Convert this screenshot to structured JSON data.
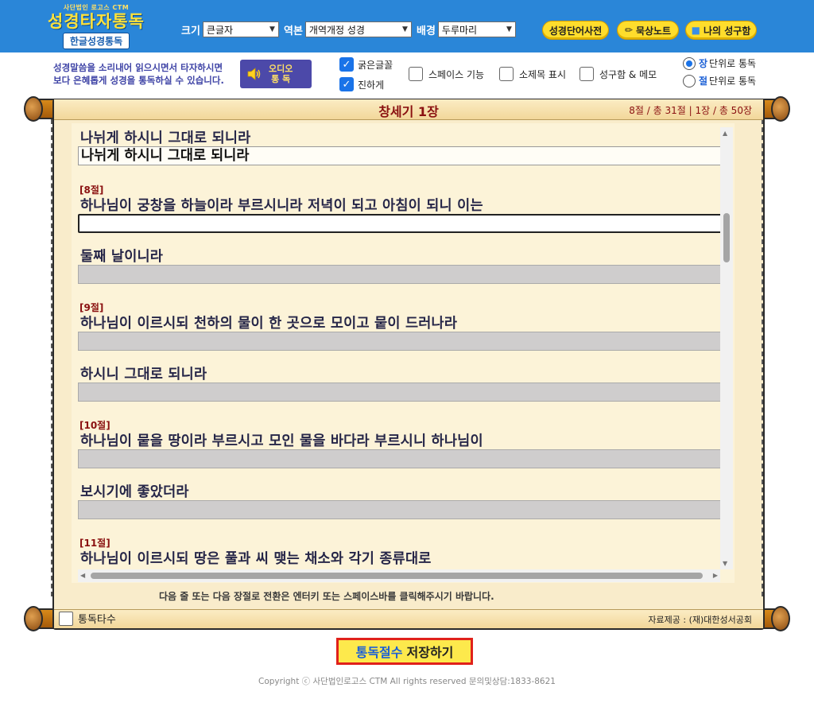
{
  "header": {
    "logo_sub": "사단법인 로고스 CTM",
    "logo_main": "성경타자통독",
    "logo_pill": "한글성경통독",
    "size_label": "크기",
    "size_value": "큰글자",
    "version_label": "역본",
    "version_value": "개역개정 성경",
    "background_label": "배경",
    "background_value": "두루마리",
    "buttons": {
      "dictionary": "성경단어사전",
      "notebook": "묵상노트",
      "my_verses": "나의 성구함"
    }
  },
  "options": {
    "notice_line1": "성경말씀을 소리내어 읽으시면서 타자하시면",
    "notice_line2": "보다 은혜롭게 성경을 통독하실 수 있습니다.",
    "audio_line1": "오디오",
    "audio_line2": "통  독",
    "bold_font": "굵은글꼴",
    "darker": "진하게",
    "space_feature": "스페이스 기능",
    "subtitle_show": "소제목 표시",
    "verse_memo": "성구함 & 메모",
    "radio_chapter_key": "장",
    "radio_chapter_rest": "단위로 통독",
    "radio_verse_key": "절",
    "radio_verse_rest": "단위로 통독"
  },
  "scroll": {
    "chapter_title": "창세기 1장",
    "progress": "8절 / 총 31절  |  1장 / 총 50장"
  },
  "reading": {
    "lines": [
      {
        "text": "나뉘게 하시니 그대로 되니라",
        "typed": "나뉘게 하시니 그대로 되니라"
      },
      {
        "verse": "[8절]",
        "text": "하나님이 궁창을 하늘이라 부르시니라 저녁이 되고 아침이 되니 이는"
      },
      {
        "text": "둘째 날이니라"
      },
      {
        "verse": "[9절]",
        "text": "하나님이 이르시되 천하의 물이 한 곳으로 모이고 뭍이 드러나라"
      },
      {
        "text": "하시니 그대로 되니라"
      },
      {
        "verse": "[10절]",
        "text": "하나님이 뭍을 땅이라 부르시고 모인 물을 바다라 부르시니 하나님이"
      },
      {
        "text": "보시기에 좋았더라"
      },
      {
        "verse": "[11절]",
        "text": "하나님이 이르시되 땅은 풀과 씨 맺는 채소와 각기 종류대로"
      }
    ],
    "hint": "다음 줄 또는 다음 장절로 전환은 엔터키 또는 스페이스바를 클릭해주시기 바랍니다."
  },
  "footer": {
    "count_label": "통독타수",
    "source": "자료제공 : (재)대한성서공회",
    "save_blue": "통독절수",
    "save_dark": "저장하기",
    "copyright": "Copyright ⓒ 사단법인로고스 CTM All rights reserved 문의및상담:1833-8621"
  }
}
